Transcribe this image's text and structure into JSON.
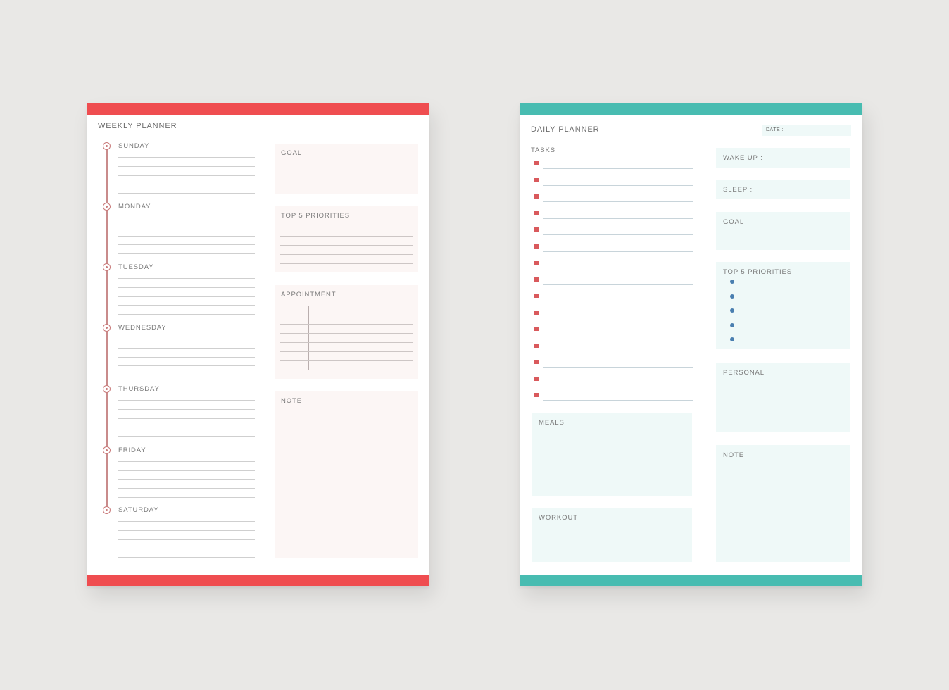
{
  "weekly": {
    "title": "WEEKLY PLANNER",
    "accent_color": "#ef4d50",
    "days": [
      "SUNDAY",
      "MONDAY",
      "TUESDAY",
      "WEDNESDAY",
      "THURSDAY",
      "FRIDAY",
      "SATURDAY"
    ],
    "lines_per_day": 5,
    "goal_label": "GOAL",
    "priorities_label": "TOP 5 PRIORITIES",
    "priority_lines": 5,
    "appointment_label": "APPOINTMENT",
    "appointment_rows": 7,
    "note_label": "NOTE"
  },
  "daily": {
    "title": "DAILY PLANNER",
    "accent_color": "#48bcb1",
    "date_label": "DATE :",
    "tasks_label": "TASKS",
    "task_count": 15,
    "wake_up_label": "WAKE UP :",
    "sleep_label": "SLEEP :",
    "goal_label": "GOAL",
    "priorities_label": "TOP 5 PRIORITIES",
    "priority_bullets": 5,
    "personal_label": "PERSONAL",
    "note_label": "NOTE",
    "meals_label": "MEALS",
    "workout_label": "WORKOUT"
  }
}
